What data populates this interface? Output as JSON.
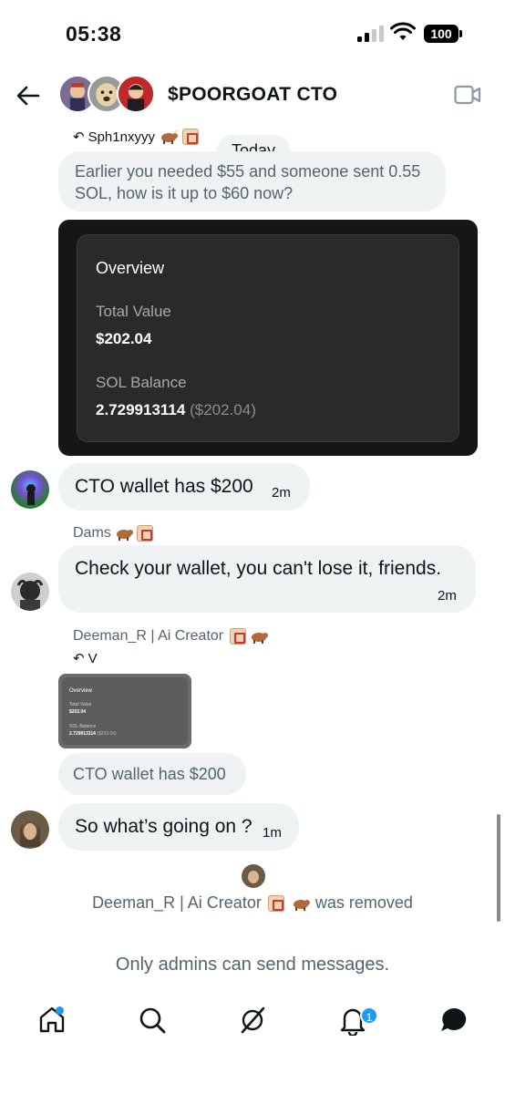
{
  "status_bar": {
    "time": "05:38",
    "battery": "100"
  },
  "header": {
    "title": "$POORGOAT CTO"
  },
  "day_divider": "Today",
  "messages": {
    "m1": {
      "reply_to": "Sph1nxyyy",
      "text": "Earlier you needed $55 and someone sent 0.55 SOL, how is it up to $60 now?"
    },
    "overview": {
      "title": "Overview",
      "total_value_label": "Total Value",
      "total_value": "$202.04",
      "sol_balance_label": "SOL Balance",
      "sol_balance": "2.729913114",
      "sol_balance_usd": "($202.04)"
    },
    "m2": {
      "text": "CTO wallet has $200",
      "time": "2m"
    },
    "m3": {
      "sender": "Dams",
      "text": "Check your wallet, you can't lose it, friends.",
      "time": "2m"
    },
    "m4": {
      "sender": "Deeman_R | Ai Creator",
      "reply_to": "V",
      "mini_card": {
        "title": "Overview",
        "total_label": "Total Value",
        "total": "$202.04",
        "sol_label": "SOL Balance",
        "sol": "2.729913114",
        "sol_usd": "($202.04)"
      },
      "quoted_text": "CTO wallet has $200"
    },
    "m5": {
      "text": "So what’s going on ?",
      "time": "1m"
    }
  },
  "system": {
    "removed_name": "Deeman_R | Ai Creator",
    "removed_suffix": "was removed",
    "admins_only": "Only admins can send messages."
  },
  "tabbar": {
    "notifications_count": "1"
  },
  "colors": {
    "accent": "#1d9bf0",
    "bubble": "#eff3f4",
    "muted": "#536471"
  }
}
